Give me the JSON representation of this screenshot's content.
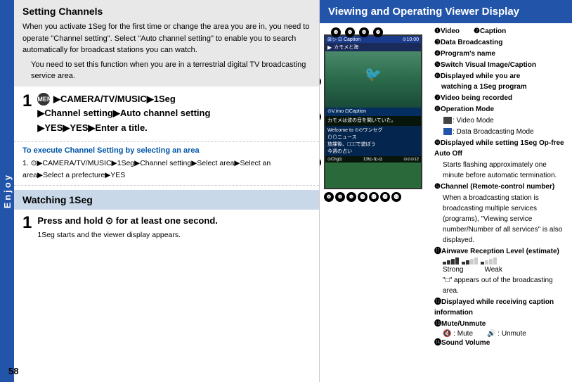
{
  "left": {
    "section1_title": "Setting Channels",
    "section1_p1": "When you activate 1Seg for the first time or change the area you are in, you need to operate \"Channel setting\". Select \"Auto channel setting\" to enable you to search automatically for broadcast stations you can watch.",
    "section1_bullet": "You need to set this function when you are in a terrestrial digital TV broadcasting service area.",
    "step1_number": "1",
    "step1_line1": "▶CAMERA/TV/MUSIC▶1Seg",
    "step1_line2": "▶Channel setting▶Auto channel setting",
    "step1_line3": "▶YES▶YES▶Enter a title.",
    "area_step_title": "To execute Channel Setting by selecting an area",
    "area_step_content": "1. ⊙▶CAMERA/TV/MUSIC▶1Seg▶Channel setting▶Select area▶Select an area▶Select a prefecture▶YES",
    "section2_title": "Watching 1Seg",
    "step2_number": "1",
    "step2_line1": "Press and hold ⊙ for at least one second.",
    "step2_sub": "1Seg starts and the viewer display appears.",
    "page_num": "58",
    "enjoy_label": "Enjoy"
  },
  "right": {
    "header": "Viewing and Operating Viewer Display",
    "items": [
      {
        "num": "❶",
        "label": "Video"
      },
      {
        "num": "❷",
        "label": "Caption"
      },
      {
        "num": "❸",
        "label": "Data Broadcasting"
      },
      {
        "num": "❹",
        "label": "Program's name"
      },
      {
        "num": "❺",
        "label": "Switch Visual Image/Caption"
      },
      {
        "num": "❻",
        "label": "Displayed while you are watching a 1Seg program"
      },
      {
        "num": "❼",
        "label": "Video being recorded"
      },
      {
        "num": "❽",
        "label": "Operation Mode"
      },
      {
        "num": "",
        "label": "Video Mode icon"
      },
      {
        "num": "",
        "label": "Data Broadcasting Mode"
      },
      {
        "num": "❾",
        "label": "Displayed while setting 1Seg Op-free Auto Off"
      },
      {
        "num": "",
        "label": "Starts flashing approximately one minute before automatic termination."
      },
      {
        "num": "❿",
        "label": "Channel (Remote-control number)"
      },
      {
        "num": "",
        "label": "When a broadcasting station is broadcasting multiple services (programs), \"Viewing service number/Number of all services\" is also displayed."
      },
      {
        "num": "⓫",
        "label": "Airwave Reception Level (estimate)"
      },
      {
        "num": "",
        "label": "Strong    Weak"
      },
      {
        "num": "",
        "label": "\"□\" appears out of the broadcasting area."
      },
      {
        "num": "⓬",
        "label": "Displayed while receiving caption information"
      },
      {
        "num": "⓭",
        "label": "Mute/Unmute"
      },
      {
        "num": "",
        "label": "Mute    Unmute"
      },
      {
        "num": "⓮",
        "label": "Sound Volume"
      }
    ]
  }
}
